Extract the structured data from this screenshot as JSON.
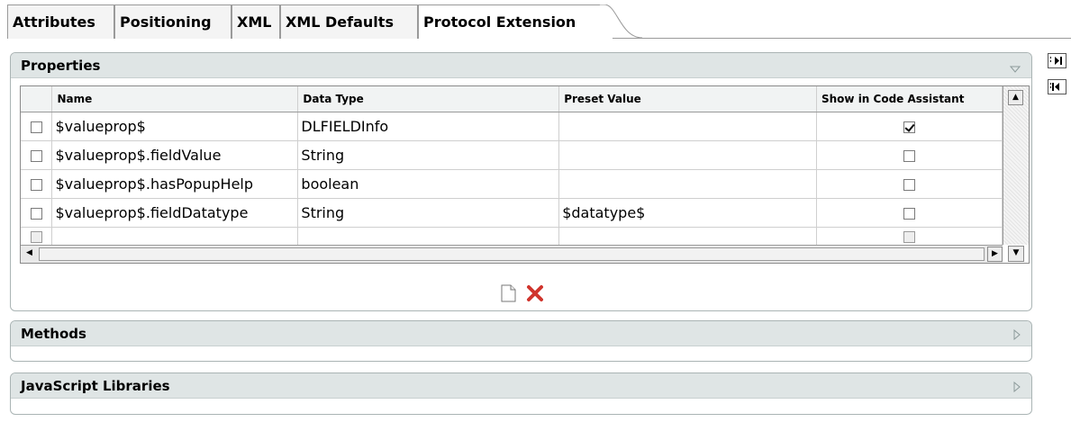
{
  "tabs": [
    {
      "label": "Attributes",
      "active": false
    },
    {
      "label": "Positioning",
      "active": false
    },
    {
      "label": "XML",
      "active": false
    },
    {
      "label": "XML Defaults",
      "active": false
    },
    {
      "label": "Protocol Extension",
      "active": true
    }
  ],
  "panels": {
    "properties": {
      "title": "Properties",
      "expanded": true,
      "arrow_icon": "chevron-down-icon"
    },
    "methods": {
      "title": "Methods",
      "expanded": false,
      "arrow_icon": "chevron-right-icon"
    },
    "js_libraries": {
      "title": "JavaScript Libraries",
      "expanded": false,
      "arrow_icon": "chevron-right-icon"
    }
  },
  "table": {
    "columns": [
      "Name",
      "Data Type",
      "Preset Value",
      "Show in Code Assistant"
    ],
    "rows": [
      {
        "selected": false,
        "name": "$valueprop$",
        "data_type": "DLFIELDInfo",
        "preset_value": "",
        "show_in_code_assistant": true
      },
      {
        "selected": false,
        "name": "$valueprop$.fieldValue",
        "data_type": "String",
        "preset_value": "",
        "show_in_code_assistant": false
      },
      {
        "selected": false,
        "name": "$valueprop$.hasPopupHelp",
        "data_type": "boolean",
        "preset_value": "",
        "show_in_code_assistant": false
      },
      {
        "selected": false,
        "name": "$valueprop$.fieldDatatype",
        "data_type": "String",
        "preset_value": "$datatype$",
        "show_in_code_assistant": false
      },
      {
        "selected": false,
        "name": "",
        "data_type": "",
        "preset_value": "",
        "show_in_code_assistant": false,
        "disabled": true
      }
    ]
  },
  "toolbar": {
    "new_icon": "new-document-icon",
    "delete_icon": "delete-x-icon"
  },
  "side_buttons": [
    "collapse-right-icon",
    "expand-left-icon"
  ],
  "colors": {
    "header_bg": "#dfe5e5",
    "delete_red": "#d0342c"
  }
}
